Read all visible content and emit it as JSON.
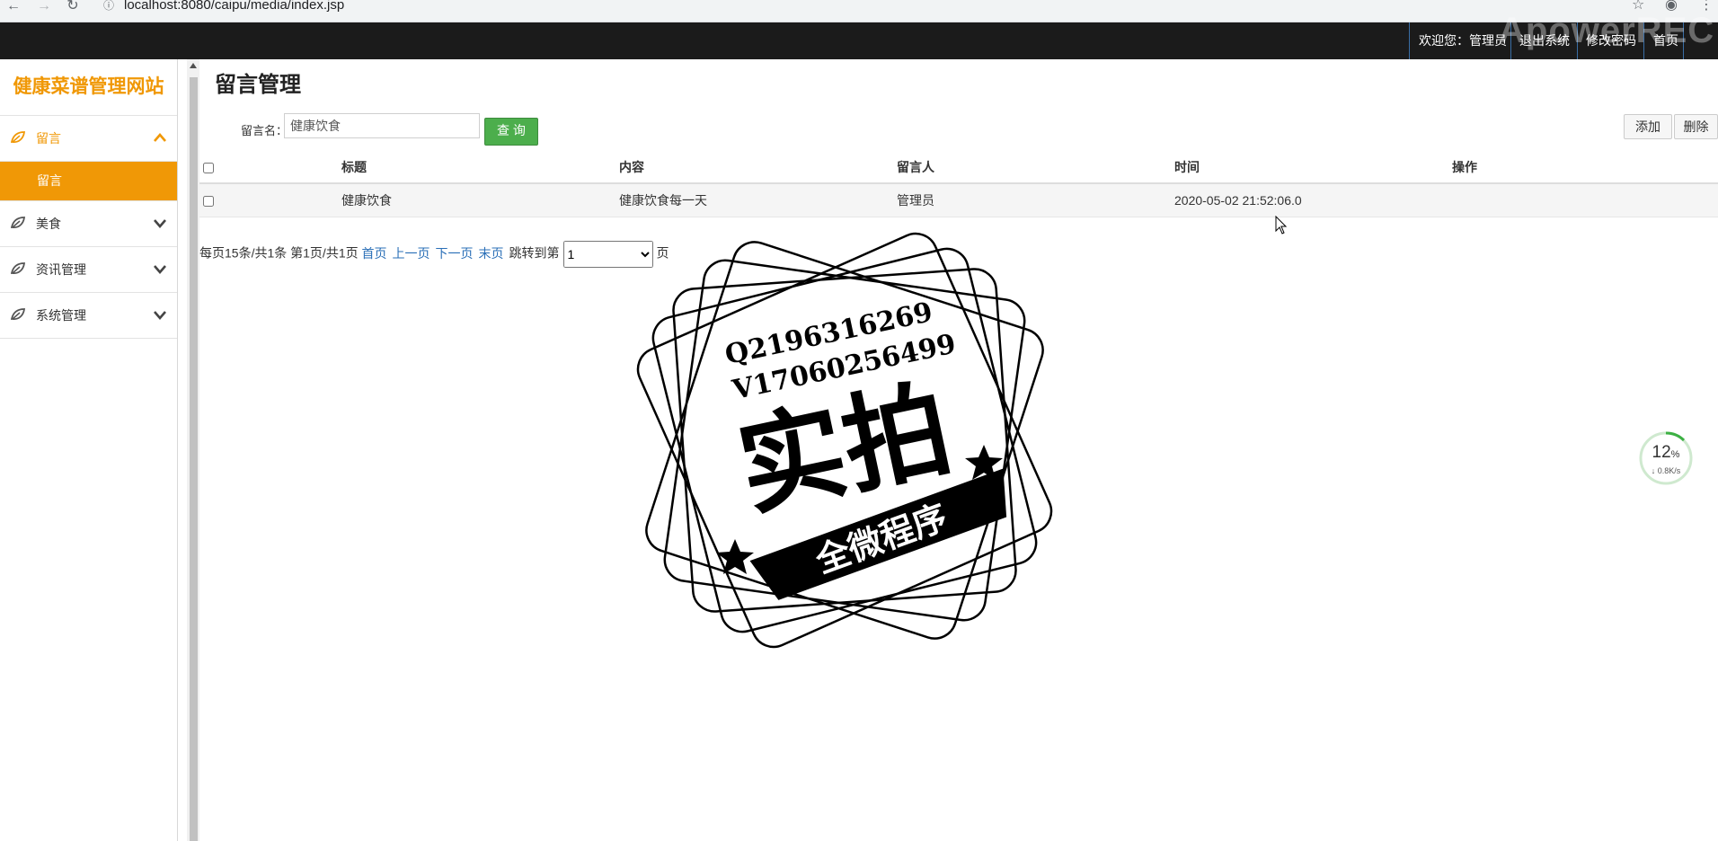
{
  "browser": {
    "url": "localhost:8080/caipu/media/index.jsp"
  },
  "header": {
    "welcome": "欢迎您：管理员",
    "logout": "退出系统",
    "change_password": "修改密码",
    "home": "首页",
    "watermark": "ApowerREC"
  },
  "sidebar": {
    "brand": "健康菜谱管理网站",
    "menus": [
      {
        "label": "留言",
        "expanded": true,
        "items": [
          {
            "label": "留言"
          }
        ]
      },
      {
        "label": "美食",
        "expanded": false
      },
      {
        "label": "资讯管理",
        "expanded": false
      },
      {
        "label": "系统管理",
        "expanded": false
      }
    ]
  },
  "main": {
    "title": "留言管理",
    "search": {
      "label": "留言名：",
      "value": "健康饮食",
      "button": "查 询"
    },
    "actions": {
      "add": "添加",
      "delete": "删除"
    },
    "table": {
      "columns": [
        "标题",
        "内容",
        "留言人",
        "时间",
        "操作"
      ],
      "rows": [
        {
          "title": "健康饮食",
          "content": "健康饮食每一天",
          "author": "管理员",
          "time": "2020-05-02 21:52:06.0",
          "ops": ""
        }
      ]
    },
    "pager": {
      "summary": "每页15条/共1条 第1页/共1页",
      "first": "首页",
      "prev": "上一页",
      "next": "下一页",
      "last": "末页",
      "jump_label": "跳转到第",
      "page_value": "1",
      "page_suffix": "页"
    }
  },
  "stamp": {
    "line1": "Q2196316269",
    "line2": "V17060256499",
    "main": "实拍",
    "banner": "全微程序"
  },
  "speed_widget": {
    "percent": "12",
    "percent_unit": "%",
    "rate": "↓ 0.8K/s"
  },
  "colors": {
    "accent": "#f09806",
    "header_bg": "#1b1b1b",
    "search_button": "#4cae4c"
  }
}
